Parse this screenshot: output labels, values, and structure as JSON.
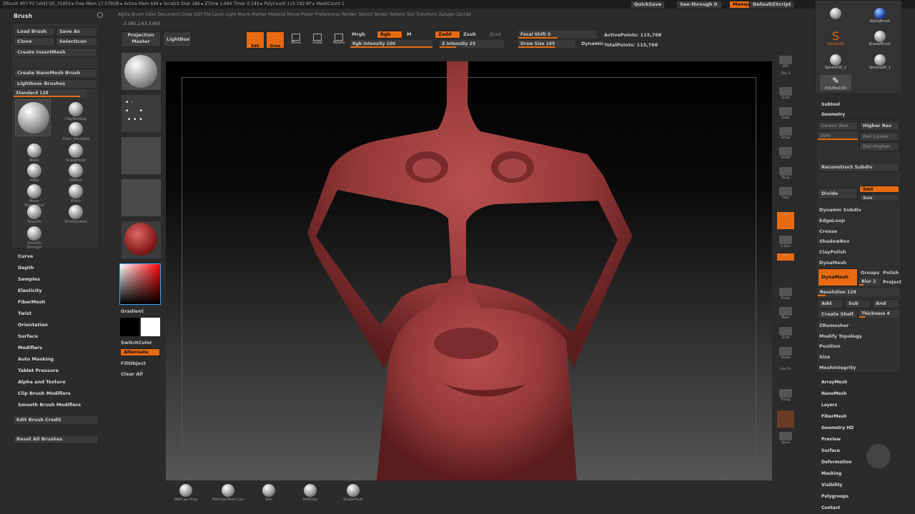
{
  "title_bar": "ZBrush 4R7 P3 [x64]   QS_31959   ▸ Free Mem 17.579GB ▸ Active Mem 644 ▸ Scratch Disk 186 ▸ ZTime 1.694 Timer 0.143 ▸ PolyCount 115.192 KP ▸ MeshCount 1",
  "title_right": {
    "quicksave": "QuickSave",
    "seethrough": "See-through 0",
    "menus": "Menus",
    "script": "DefaultZScript"
  },
  "menubar": "Alpha  Brush  Color  Document  Draw  Edit  File  Layer  Light  Macro  Marker  Material  Movie  Picker  Preferences  Render  Stencil  Stroke  Texture  Tool  Transform  Zplugin  Zscript",
  "coords": "-3.585,2.63,3.655",
  "brush_panel": {
    "title": "Brush",
    "load": "Load Brush",
    "saveas": "Save As",
    "clone": "Clone",
    "select": "SelectIcon",
    "goz": "Create InsertMesh",
    "nano": "Create NanoMesh Brush",
    "lb": "Lightbox▸ Brushes",
    "standard": "Standard 128",
    "main": "Standard",
    "icons": [
      "Standard",
      "ClayBuildup",
      "Dam_Standard",
      "Move",
      "SnakeHook",
      "Inflat",
      "hPolish",
      "Move Topological",
      "Pinch",
      "Smooth",
      "TrimDynamic",
      "Smooth Stronger",
      "Smooth"
    ]
  },
  "left_menus": [
    "Curve",
    "Depth",
    "Samples",
    "Elasticity",
    "FiberMesh",
    "Twist",
    "Orientation",
    "Surface",
    "Modifiers",
    "Auto Masking",
    "Tablet Pressure",
    "Alpha and Texture",
    "Clip Brush Modifiers",
    "Smooth Brush Modifiers"
  ],
  "edit_credit": "Edit Brush Credit",
  "reset_all": "Reset All Brushes",
  "proj_master": "Projection Master",
  "lightbox": "LightBox",
  "top": {
    "edit": "Edit",
    "draw": "Draw",
    "move": "Move",
    "scale": "Scale",
    "rotate": "Rotate",
    "mrgb": "Mrgb",
    "rgb": "Rgb",
    "m": "M",
    "rgb_intensity": "Rgb Intensity 100",
    "zadd": "Zadd",
    "zsub": "Zsub",
    "zcut": "Zcut",
    "z_intensity": "Z Intensity 25",
    "focal": "Focal Shift 0",
    "draw_size": "Draw Size 165",
    "dynamic": "Dynamic",
    "active_points": "ActivePoints: 115,768",
    "total_points": "TotalPoints: 115,768"
  },
  "color": {
    "gradient": "Gradient",
    "switch": "SwitchColor",
    "alternate": "Alternate",
    "fill": "FillObject"
  },
  "mid_labels": [
    "Standard",
    "Dots",
    "Alpha Off",
    "Texture Off",
    "MatCap Red Wax",
    "Clear All"
  ],
  "right_tools": [
    "BPR",
    "SPix 3",
    "Scroll",
    "Zoom",
    "Actual",
    "AAHalf",
    "Persp",
    "Floor",
    "Local",
    "L.Sym",
    "Xyz",
    "Frame",
    "Move",
    "Scale",
    "Rotate",
    "Line Fill",
    "PolyF",
    "Transp",
    "Dynamic",
    "Solo",
    "Xpose"
  ],
  "right_panel": {
    "subtool": "Subtool",
    "geometry": "Geometry",
    "lower": "Lower Res",
    "higher": "Higher Res",
    "sdiv": "SDiv",
    "del_lower": "Del Lower",
    "del_higher": "Del Higher",
    "reconstruct": "Reconstruct Subdiv",
    "divide": "Divide",
    "smt": "Smt",
    "suv": "Suv",
    "dyn_subdiv": "Dynamic Subdiv",
    "edgeloop": "EdgeLoop",
    "crease": "Crease",
    "shadowbox": "ShadowBox",
    "claypolish": "ClayPolish",
    "dynamesh_h": "DynaMesh",
    "dynamesh": "DynaMesh",
    "groups": "Groups",
    "polish": "Polish",
    "blur": "Blur 2",
    "project": "Project",
    "resolution": "Resolution 128",
    "add": "Add",
    "sub": "Sub",
    "and": "And",
    "shell": "Create Shell",
    "thickness": "Thickness 4",
    "zremesher": "ZRemesher",
    "modify": "Modify Topology",
    "position": "Position",
    "size": "Size",
    "integrity": "MeshIntegrity",
    "menus": [
      "ArrayMesh",
      "NanoMesh",
      "Layers",
      "FiberMesh",
      "Geometry HD",
      "Preview",
      "Surface",
      "Deformation",
      "Masking",
      "Visibility",
      "Polygroups",
      "Contact"
    ],
    "tools_top": [
      "SimpleBrush",
      "AlphaBrush",
      "Sphere3D",
      "EraserBrush",
      "Sphere3D_1",
      "Sphere3D_1",
      "PolyMesh3D"
    ]
  },
  "bottom_mats": [
    "MatCap Gray",
    "MatCap Pearl Cav",
    "Skin",
    "SoftClay",
    "SnakeHook"
  ]
}
